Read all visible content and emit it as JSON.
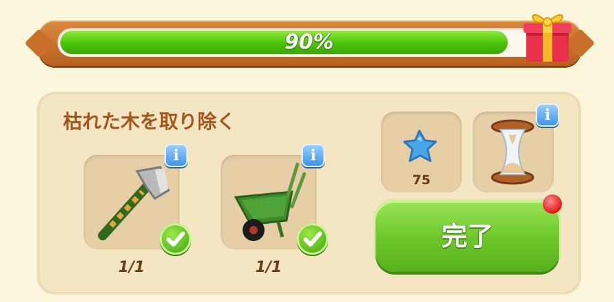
{
  "progress": {
    "value": 0.9,
    "label": "90%",
    "fill_color": "#4cc20c"
  },
  "reward_icon": "gift-box-icon",
  "task": {
    "title": "枯れた木を取り除く",
    "tools": [
      {
        "name": "axe",
        "icon": "axe-icon",
        "count": "1/1",
        "complete": true
      },
      {
        "name": "wheelbarrow",
        "icon": "wheelbarrow-icon",
        "count": "1/1",
        "complete": true
      }
    ],
    "rewards": [
      {
        "icon": "blue-star-icon",
        "count": "75"
      },
      {
        "icon": "hourglass-icon"
      }
    ],
    "info_label": "i",
    "done_label": "完了"
  },
  "colors": {
    "accent_green": "#6cc62a",
    "title_brown": "#a5561d",
    "notification_red": "#e01a1a"
  }
}
